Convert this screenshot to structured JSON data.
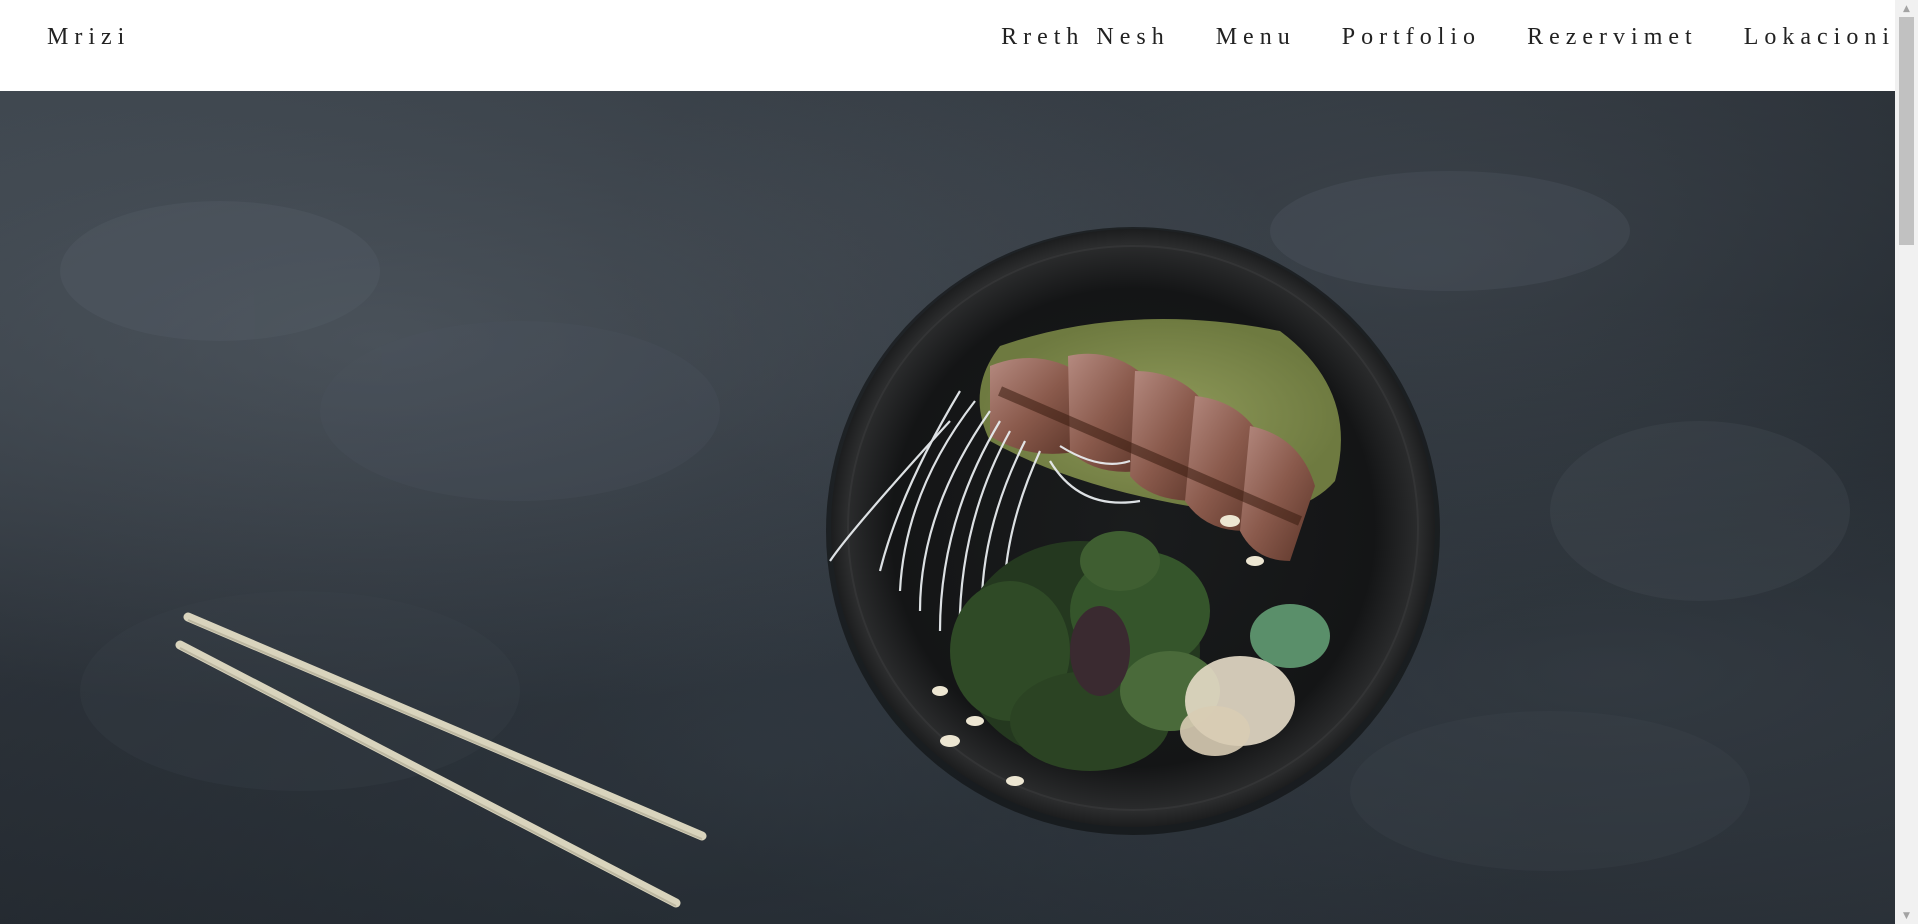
{
  "header": {
    "brand": "Mrizi",
    "nav": [
      {
        "label": "Rreth Nesh"
      },
      {
        "label": "Menu"
      },
      {
        "label": "Portfolio"
      },
      {
        "label": "Rezervimet"
      },
      {
        "label": "Lokacioni"
      }
    ]
  },
  "hero": {
    "image": "food-bowl-with-chopsticks"
  },
  "colors": {
    "header_bg": "#ffffff",
    "text": "#222222",
    "hero_bg": "#2a3037"
  }
}
